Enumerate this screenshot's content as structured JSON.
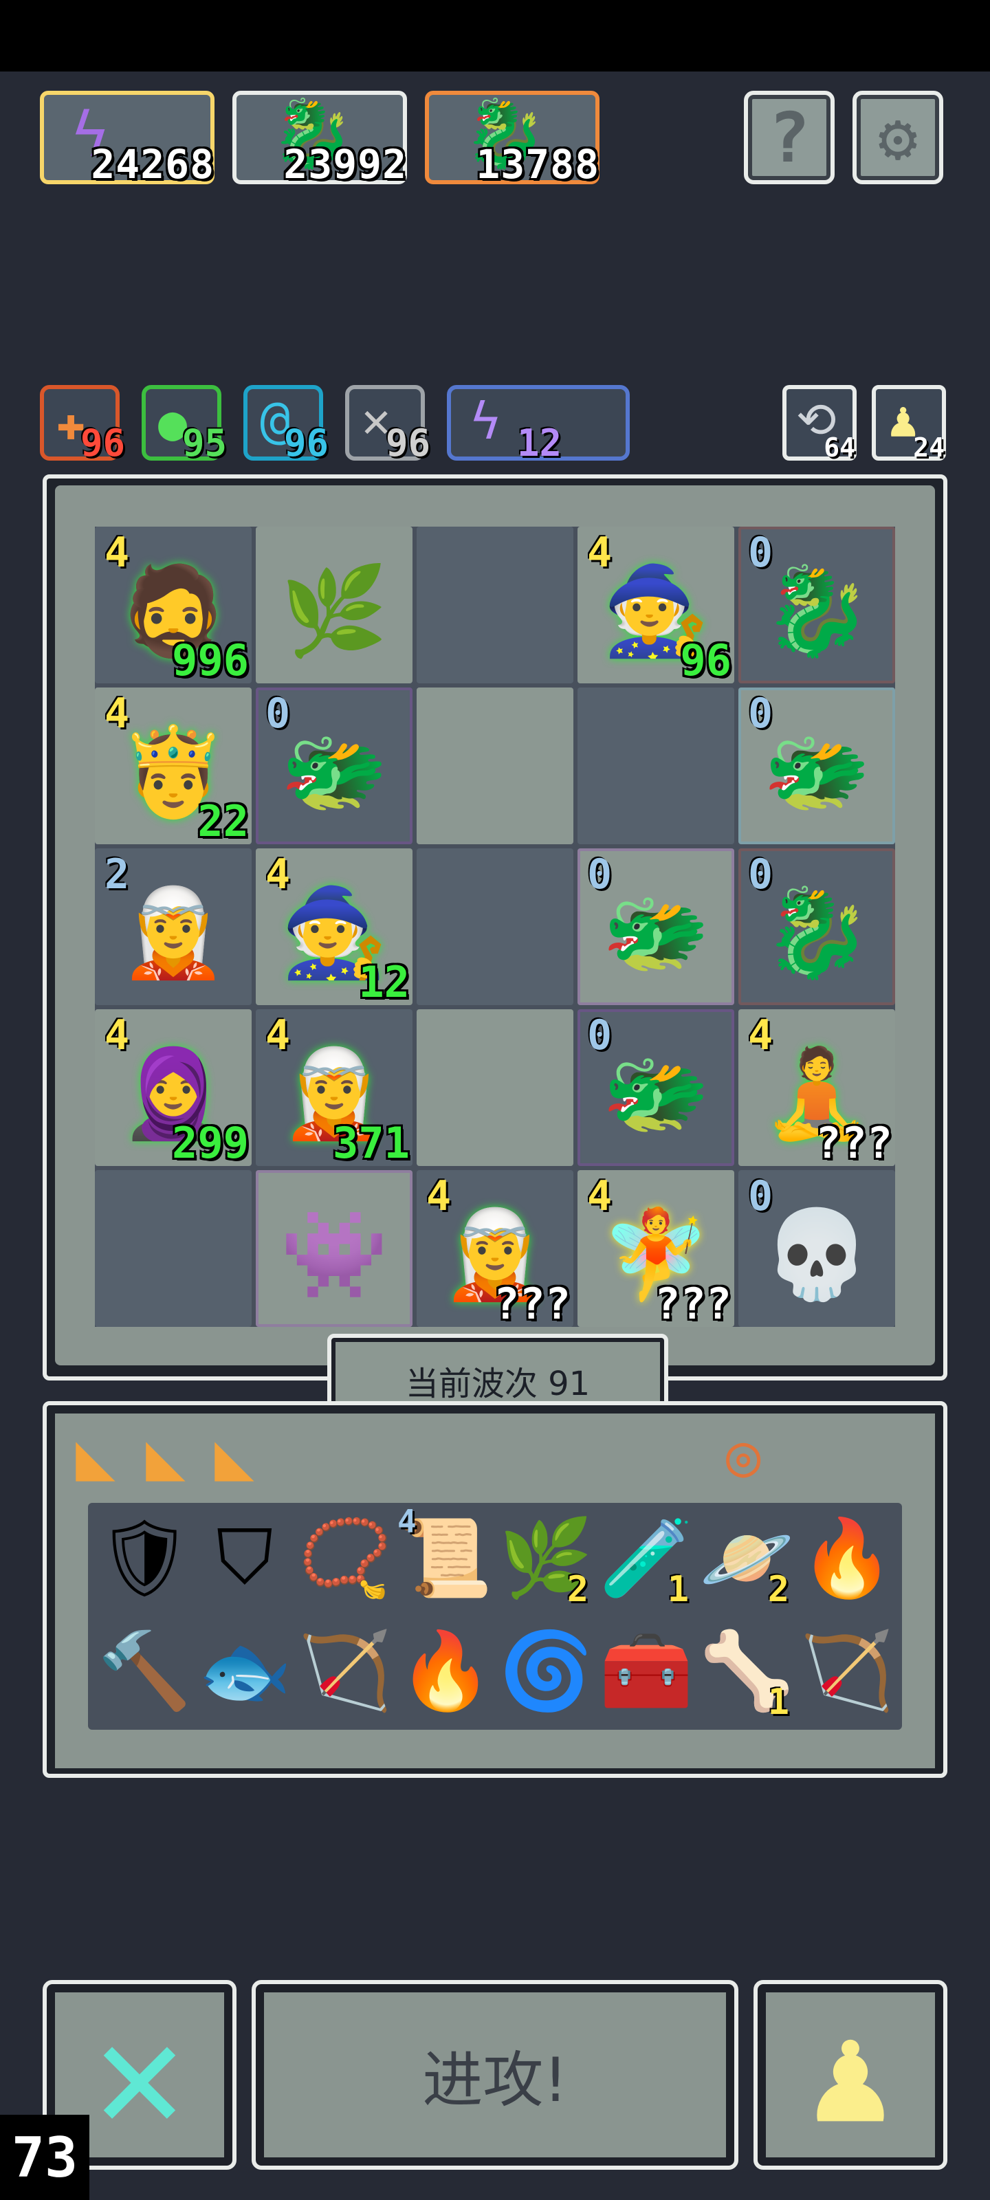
{
  "resources": [
    {
      "icon": "lightning-icon",
      "value": "24268",
      "border": "#f7d66a"
    },
    {
      "icon": "red-dragon-icon",
      "value": "23992",
      "border": "#e9ecea"
    },
    {
      "icon": "red-dragon-icon",
      "value": "13788",
      "border": "#f08a3c"
    }
  ],
  "header_buttons": [
    {
      "name": "help-button",
      "icon": "question-icon",
      "glyph": "?"
    },
    {
      "name": "settings-button",
      "icon": "gear-icon",
      "glyph": "⚙"
    }
  ],
  "elements": [
    {
      "icon": "fire-element-icon",
      "glyph": "✚",
      "value": "96",
      "color": "#ff4a3a",
      "border": "#d9572a"
    },
    {
      "icon": "nature-element-icon",
      "glyph": "●",
      "value": "95",
      "color": "#55e05a",
      "border": "#3cbf3f"
    },
    {
      "icon": "water-element-icon",
      "glyph": "@",
      "value": "96",
      "color": "#38c4e8",
      "border": "#1ea3c9"
    },
    {
      "icon": "wind-element-icon",
      "glyph": "✕",
      "value": "96",
      "color": "#d0d0d0",
      "border": "#9ea3a8"
    },
    {
      "icon": "lightning-element-icon",
      "glyph": "ϟ",
      "value": "12",
      "color": "#b48bf7",
      "border": "#5577cf"
    }
  ],
  "utility_buttons": [
    {
      "name": "reroll-button",
      "icon": "reroll-icon",
      "glyph": "⟲",
      "value": "64"
    },
    {
      "name": "pawn-counter-button",
      "icon": "pawn-icon",
      "glyph": "♟",
      "value": "24"
    }
  ],
  "board": [
    [
      {
        "unit": "warrior",
        "icon": "warrior-icon",
        "glyph": "🧔",
        "level": "4",
        "level_color": "yellow",
        "hp": "996",
        "hp_color": "green",
        "outline": "#2ee63a"
      },
      {
        "unit": "crystal-plant",
        "icon": "crystal-plant-icon",
        "glyph": "🌿"
      },
      {},
      {
        "unit": "hooded-mage",
        "icon": "hooded-mage-icon",
        "glyph": "🧙",
        "level": "4",
        "level_color": "yellow",
        "hp": "96",
        "hp_color": "green",
        "outline": "#2ee63a"
      },
      {
        "unit": "red-dragon",
        "icon": "red-dragon-icon",
        "glyph": "🐉",
        "level": "0",
        "level_color": "blue",
        "tint": "#c0452f"
      }
    ],
    [
      {
        "unit": "king",
        "icon": "king-icon",
        "glyph": "🤴",
        "level": "4",
        "level_color": "yellow",
        "hp": "22",
        "hp_color": "green",
        "outline": "#2ee63a"
      },
      {
        "unit": "purple-dragon",
        "icon": "purple-dragon-icon",
        "glyph": "🐲",
        "level": "0",
        "level_color": "blue",
        "tint": "#9a38c4"
      },
      {},
      {},
      {
        "unit": "ice-dragon",
        "icon": "ice-dragon-icon",
        "glyph": "🐲",
        "level": "0",
        "level_color": "blue",
        "tint": "#5ab8e8"
      }
    ],
    [
      {
        "unit": "swordsman",
        "icon": "swordsman-icon",
        "glyph": "🧝",
        "level": "2",
        "level_color": "blue"
      },
      {
        "unit": "hooded-mage",
        "icon": "hooded-mage-icon",
        "glyph": "🧙",
        "level": "4",
        "level_color": "yellow",
        "hp": "12",
        "hp_color": "green",
        "outline": "#2ee63a"
      },
      {},
      {
        "unit": "purple-dragon",
        "icon": "purple-dragon-icon",
        "glyph": "🐲",
        "level": "0",
        "level_color": "blue",
        "tint": "#9a38c4"
      },
      {
        "unit": "red-dragon",
        "icon": "red-dragon-icon",
        "glyph": "🐉",
        "level": "0",
        "level_color": "blue",
        "tint": "#c0452f"
      }
    ],
    [
      {
        "unit": "rogue",
        "icon": "rogue-icon",
        "glyph": "🧕",
        "level": "4",
        "level_color": "yellow",
        "hp": "299",
        "hp_color": "green",
        "outline": "#2ee63a"
      },
      {
        "unit": "druid",
        "icon": "druid-icon",
        "glyph": "🧝",
        "level": "4",
        "level_color": "yellow",
        "hp": "371",
        "hp_color": "green",
        "outline": "#2ee63a"
      },
      {},
      {
        "unit": "purple-dragon",
        "icon": "purple-dragon-icon",
        "glyph": "🐲",
        "level": "0",
        "level_color": "blue",
        "tint": "#9a38c4"
      },
      {
        "unit": "monk",
        "icon": "monk-icon",
        "glyph": "🧘",
        "level": "4",
        "level_color": "yellow",
        "hp": "???",
        "hp_color": "white",
        "outline": "#2ee63a"
      }
    ],
    [
      {},
      {
        "unit": "purple-golem",
        "icon": "purple-golem-icon",
        "glyph": "👾",
        "tint": "#9a38c4"
      },
      {
        "unit": "druid",
        "icon": "druid-icon",
        "glyph": "🧝",
        "level": "4",
        "level_color": "yellow",
        "hp": "???",
        "hp_color": "white",
        "outline": "#2ee63a"
      },
      {
        "unit": "priestess",
        "icon": "priestess-icon",
        "glyph": "🧚",
        "level": "4",
        "level_color": "yellow",
        "hp": "???",
        "hp_color": "white",
        "outline": "#f2ec2c"
      },
      {
        "unit": "skeleton-sage",
        "icon": "skeleton-sage-icon",
        "glyph": "💀",
        "level": "0",
        "level_color": "blue"
      }
    ]
  ],
  "wave_label": "当前波次 91",
  "inventory_top": [
    {
      "icon": "cheese-icon",
      "glyph": "◣"
    },
    {
      "icon": "cheese-icon",
      "glyph": "◣"
    },
    {
      "icon": "cheese-icon",
      "glyph": "◣"
    }
  ],
  "ring_slot": {
    "icon": "ring-icon",
    "glyph": "◎"
  },
  "inventory": [
    {
      "icon": "orange-armor-icon",
      "glyph": "🛡",
      "count": ""
    },
    {
      "icon": "gray-shield-icon",
      "glyph": "⛉",
      "count": ""
    },
    {
      "icon": "amulet-icon",
      "glyph": "📿",
      "count": ""
    },
    {
      "icon": "fire-scroll-icon",
      "glyph": "📜",
      "count": "",
      "level": "4"
    },
    {
      "icon": "green-herb-icon",
      "glyph": "🌿",
      "count": "2"
    },
    {
      "icon": "potion-jar-icon",
      "glyph": "🧪",
      "count": "1"
    },
    {
      "icon": "orange-orb-icon",
      "glyph": "🪐",
      "count": "2"
    },
    {
      "icon": "fire-rune-icon",
      "glyph": "🔥",
      "count": ""
    },
    {
      "icon": "hammer-icon",
      "glyph": "🔨",
      "count": ""
    },
    {
      "icon": "blue-fish-icon",
      "glyph": "🐟",
      "count": ""
    },
    {
      "icon": "green-arrow-icon",
      "glyph": "🏹",
      "count": ""
    },
    {
      "icon": "fire-card-icon",
      "glyph": "🔥",
      "count": ""
    },
    {
      "icon": "wind-icon",
      "glyph": "🌀",
      "count": ""
    },
    {
      "icon": "treasure-chest-icon",
      "glyph": "🧰",
      "count": ""
    },
    {
      "icon": "white-claw-icon",
      "glyph": "🦴",
      "count": "1"
    },
    {
      "icon": "pink-arrow-icon",
      "glyph": "🏹",
      "count": ""
    }
  ],
  "bottom": {
    "cancel_icon": "close-icon",
    "attack_label": "进攻!",
    "pawn_icon": "pawn-icon",
    "counter": "73"
  }
}
